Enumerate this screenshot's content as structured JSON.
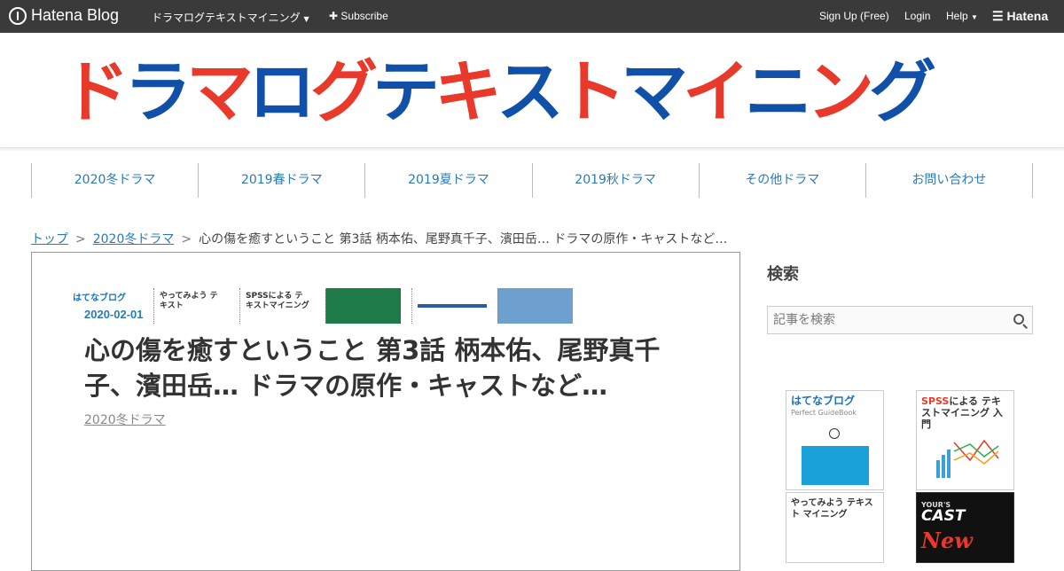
{
  "topbar": {
    "logo_text": "Hatena Blog",
    "blog_name": "ドラマログテキストマイニング",
    "subscribe": "Subscribe",
    "signup": "Sign Up (Free)",
    "login": "Login",
    "help": "Help",
    "hatena": "Hatena"
  },
  "header": {
    "banner_chars": [
      {
        "ch": "ド",
        "c": "r"
      },
      {
        "ch": "ラ",
        "c": "b"
      },
      {
        "ch": "マ",
        "c": "r"
      },
      {
        "ch": "ロ",
        "c": "b"
      },
      {
        "ch": "グ",
        "c": "r"
      },
      {
        "ch": "テ",
        "c": "b"
      },
      {
        "ch": "キ",
        "c": "r"
      },
      {
        "ch": "ス",
        "c": "b"
      },
      {
        "ch": "ト",
        "c": "r"
      },
      {
        "ch": "マ",
        "c": "b"
      },
      {
        "ch": "イ",
        "c": "r"
      },
      {
        "ch": "ニ",
        "c": "b"
      },
      {
        "ch": "ン",
        "c": "r"
      },
      {
        "ch": "グ",
        "c": "b"
      }
    ]
  },
  "nav": {
    "items": [
      "2020冬ドラマ",
      "2019春ドラマ",
      "2019夏ドラマ",
      "2019秋ドラマ",
      "その他ドラマ",
      "お問い合わせ"
    ]
  },
  "breadcrumb": {
    "top": "トップ",
    "sep": ">",
    "category": "2020冬ドラマ",
    "current": "心の傷を癒すということ 第3話 柄本佑、尾野真千子、濱田岳… ドラマの原作・キャストなど…"
  },
  "article": {
    "date": "2020-02-01",
    "title": "心の傷を癒すということ 第3話 柄本佑、尾野真千子、濱田岳… ドラマの原作・キャストなど…",
    "category": "2020冬ドラマ",
    "thumbs": [
      "はてなブログ",
      "やってみよう テキスト",
      "SPSSによる テキストマイニング",
      "",
      "",
      ""
    ]
  },
  "sidebar": {
    "search_title": "検索",
    "search_placeholder": "記事を検索",
    "book1_title": "はてなブログ",
    "book1_sub": "Perfect GuideBook",
    "book2_title_red": "SPSS",
    "book2_title_rest": "による テキストマイニング 入門",
    "book3_title": "やってみよう テキスト マイニング",
    "book4_title": "CAST",
    "book4_sub": "YOUR'S",
    "book4_tag": "New"
  },
  "colors": {
    "accent": "#2a7ab8",
    "banner_red": "#e8392b",
    "banner_blue": "#1050a8",
    "topbar": "#3a3a3a"
  }
}
